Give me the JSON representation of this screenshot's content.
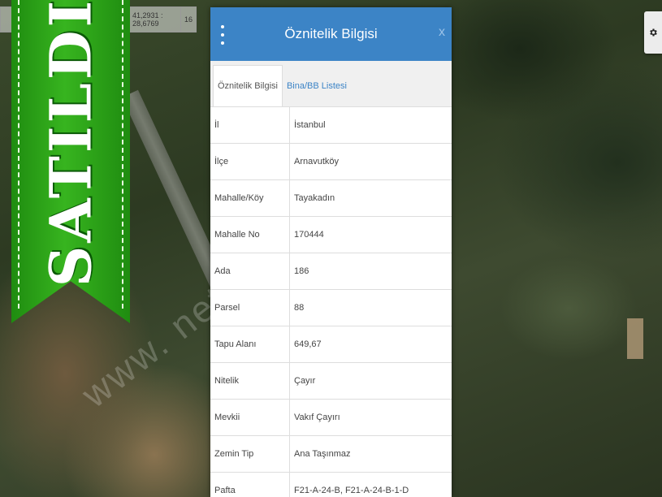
{
  "map": {
    "coordinates": "41,2931 : 28,6769",
    "zoom": "16",
    "watermark": "www.                    net.tr"
  },
  "ribbon": {
    "text": "SATILDI",
    "color": "#28a115"
  },
  "settings": {
    "icon": "gear-icon"
  },
  "panel": {
    "title": "Öznitelik Bilgisi",
    "menu_icon": "vertical-dots-icon",
    "close_label": "x",
    "header_color": "#3c84c6",
    "tabs": [
      {
        "label": "Öznitelik Bilgisi",
        "active": true
      },
      {
        "label": "Bina/BB Listesi",
        "active": false
      }
    ],
    "rows": [
      {
        "key": "İl",
        "value": "İstanbul"
      },
      {
        "key": "İlçe",
        "value": "Arnavutköy"
      },
      {
        "key": "Mahalle/Köy",
        "value": "Tayakadın"
      },
      {
        "key": "Mahalle No",
        "value": "170444"
      },
      {
        "key": "Ada",
        "value": "186"
      },
      {
        "key": "Parsel",
        "value": "88"
      },
      {
        "key": "Tapu Alanı",
        "value": "649,67"
      },
      {
        "key": "Nitelik",
        "value": "Çayır"
      },
      {
        "key": "Mevkii",
        "value": "Vakıf Çayırı"
      },
      {
        "key": "Zemin Tip",
        "value": "Ana Taşınmaz"
      },
      {
        "key": "Pafta",
        "value": "F21-A-24-B, F21-A-24-B-1-D"
      }
    ]
  }
}
